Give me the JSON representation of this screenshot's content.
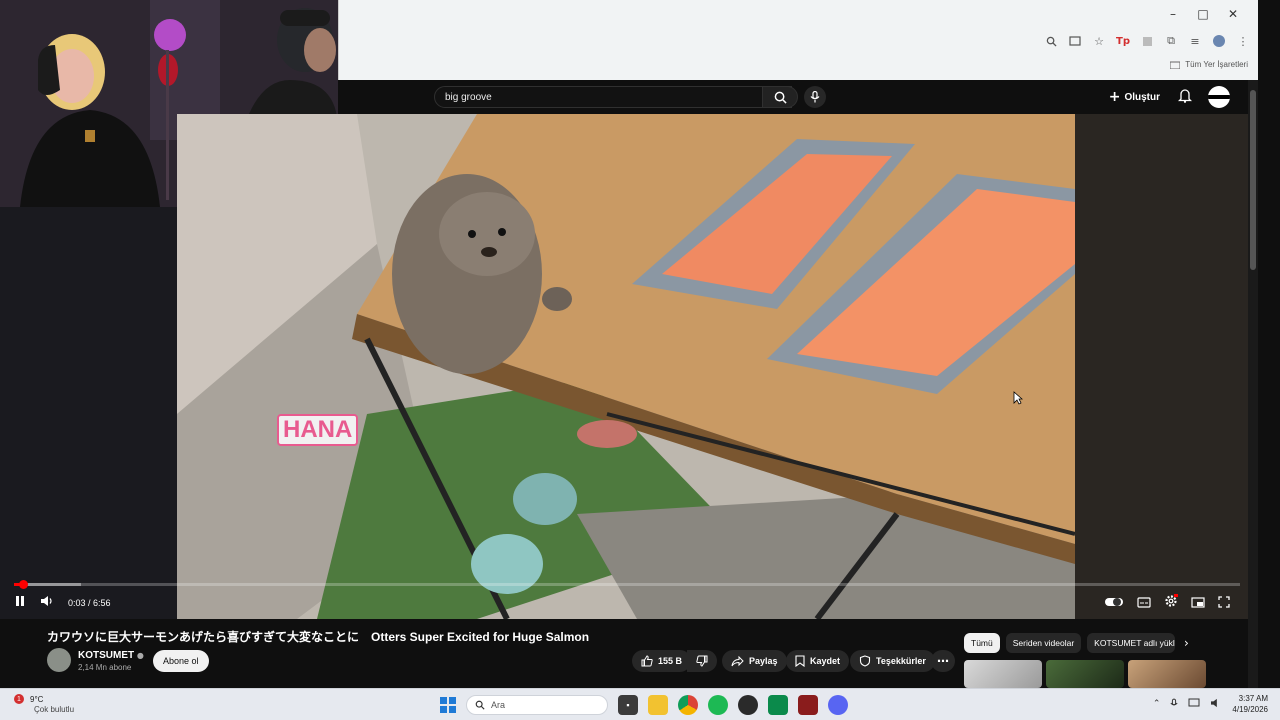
{
  "browser": {
    "window_controls": [
      "–",
      "□",
      "✕"
    ],
    "bookmarks_label": "Tüm Yer İşaretleri",
    "extension_badge": "Tp"
  },
  "header": {
    "search_value": "big groove",
    "create_label": "Oluştur"
  },
  "player": {
    "time": "0:03 / 6:56",
    "progress_fraction": 0.0072,
    "buffer_fraction": 0.055,
    "overlay_text": "HANA"
  },
  "video": {
    "title": "カワウソに巨大サーモンあげたら喜びすぎて大変なことに　Otters Super Excited for Huge Salmon",
    "channel": "KOTSUMET",
    "subscribers": "2,14 Mn abone",
    "subscribe_label": "Abone ol",
    "likes": "155 B",
    "share_label": "Paylaş",
    "save_label": "Kaydet",
    "thanks_label": "Teşekkürler"
  },
  "chips": [
    "Tümü",
    "Seriden videolar",
    "KOTSUMET adlı yükle"
  ],
  "taskbar": {
    "weather_badge": "1",
    "temperature": "9°C",
    "weather_desc": "Çok bulutlu",
    "search_placeholder": "Ara",
    "time": "3:37 AM",
    "date": "4/19/2026"
  },
  "colors": {
    "accent_red": "#ff0000",
    "yt_background": "#0f0f0f"
  }
}
